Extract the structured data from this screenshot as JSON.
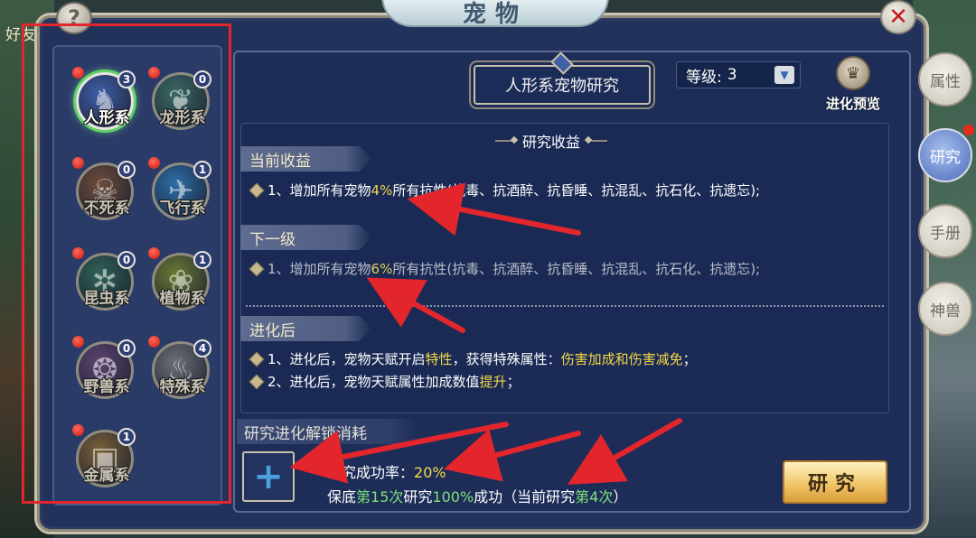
{
  "background": {
    "left_text": "好友"
  },
  "window": {
    "title": "宠物",
    "help_icon": "question-icon",
    "close_icon": "close-icon"
  },
  "categories": [
    {
      "name": "人形系",
      "count": "3",
      "red_dot": true,
      "active": true,
      "color": "#3f5fa8",
      "glyph": "♞"
    },
    {
      "name": "龙形系",
      "count": "0",
      "red_dot": true,
      "active": false,
      "color": "#3d6a66",
      "glyph": "❦"
    },
    {
      "name": "不死系",
      "count": "0",
      "red_dot": true,
      "active": false,
      "color": "#6e4c3a",
      "glyph": "☠"
    },
    {
      "name": "飞行系",
      "count": "1",
      "red_dot": true,
      "active": false,
      "color": "#2d6ea8",
      "glyph": "✈"
    },
    {
      "name": "昆虫系",
      "count": "0",
      "red_dot": true,
      "active": false,
      "color": "#2f6256",
      "glyph": "✲"
    },
    {
      "name": "植物系",
      "count": "1",
      "red_dot": true,
      "active": false,
      "color": "#6a7a34",
      "glyph": "❀"
    },
    {
      "name": "野兽系",
      "count": "0",
      "red_dot": true,
      "active": false,
      "color": "#5e4470",
      "glyph": "❂"
    },
    {
      "name": "特殊系",
      "count": "4",
      "red_dot": true,
      "active": false,
      "color": "#6e7078",
      "glyph": "♨"
    },
    {
      "name": "金属系",
      "count": "1",
      "red_dot": true,
      "active": false,
      "color": "#7a6038",
      "glyph": "▣"
    }
  ],
  "research": {
    "title": "人形系宠物研究",
    "level_label": "等级:",
    "level_value": "3",
    "evolve_preview": "进化预览",
    "income_header": "研究收益",
    "current_label": "当前收益",
    "current_line": {
      "prefix": "1、增加所有宠物",
      "pct": "4%",
      "suffix": "所有抗性(抗毒、抗酒醉、抗昏睡、抗混乱、抗石化、抗遗忘);"
    },
    "next_label": "下一级",
    "next_line": {
      "prefix": "1、增加所有宠物",
      "pct": "6%",
      "suffix": "所有抗性(抗毒、抗酒醉、抗昏睡、抗混乱、抗石化、抗遗忘);"
    },
    "evolved_label": "进化后",
    "evolved_line1": {
      "a": "1、进化后，宠物天赋开启",
      "b": "特性",
      "c": "，获得特殊属性：",
      "d": "伤害加成和伤害减免",
      "e": "；"
    },
    "evolved_line2": {
      "a": "2、进化后，宠物天赋属性加成数值",
      "b": "提升",
      "c": "；"
    },
    "unlock_label": "研究进化解锁消耗",
    "plus_glyph": "+",
    "rate": {
      "label": "研究成功率：",
      "value": "20%"
    },
    "guarantee": {
      "a": "保底",
      "b": "第15次",
      "c": "研究",
      "d": "100%",
      "e": "成功（当前研究",
      "f": "第4次",
      "g": "）"
    },
    "button": "研究"
  },
  "side_tabs": [
    {
      "label": "属性",
      "active": false
    },
    {
      "label": "研究",
      "active": true
    },
    {
      "label": "手册",
      "active": false
    },
    {
      "label": "神兽",
      "active": false
    }
  ]
}
